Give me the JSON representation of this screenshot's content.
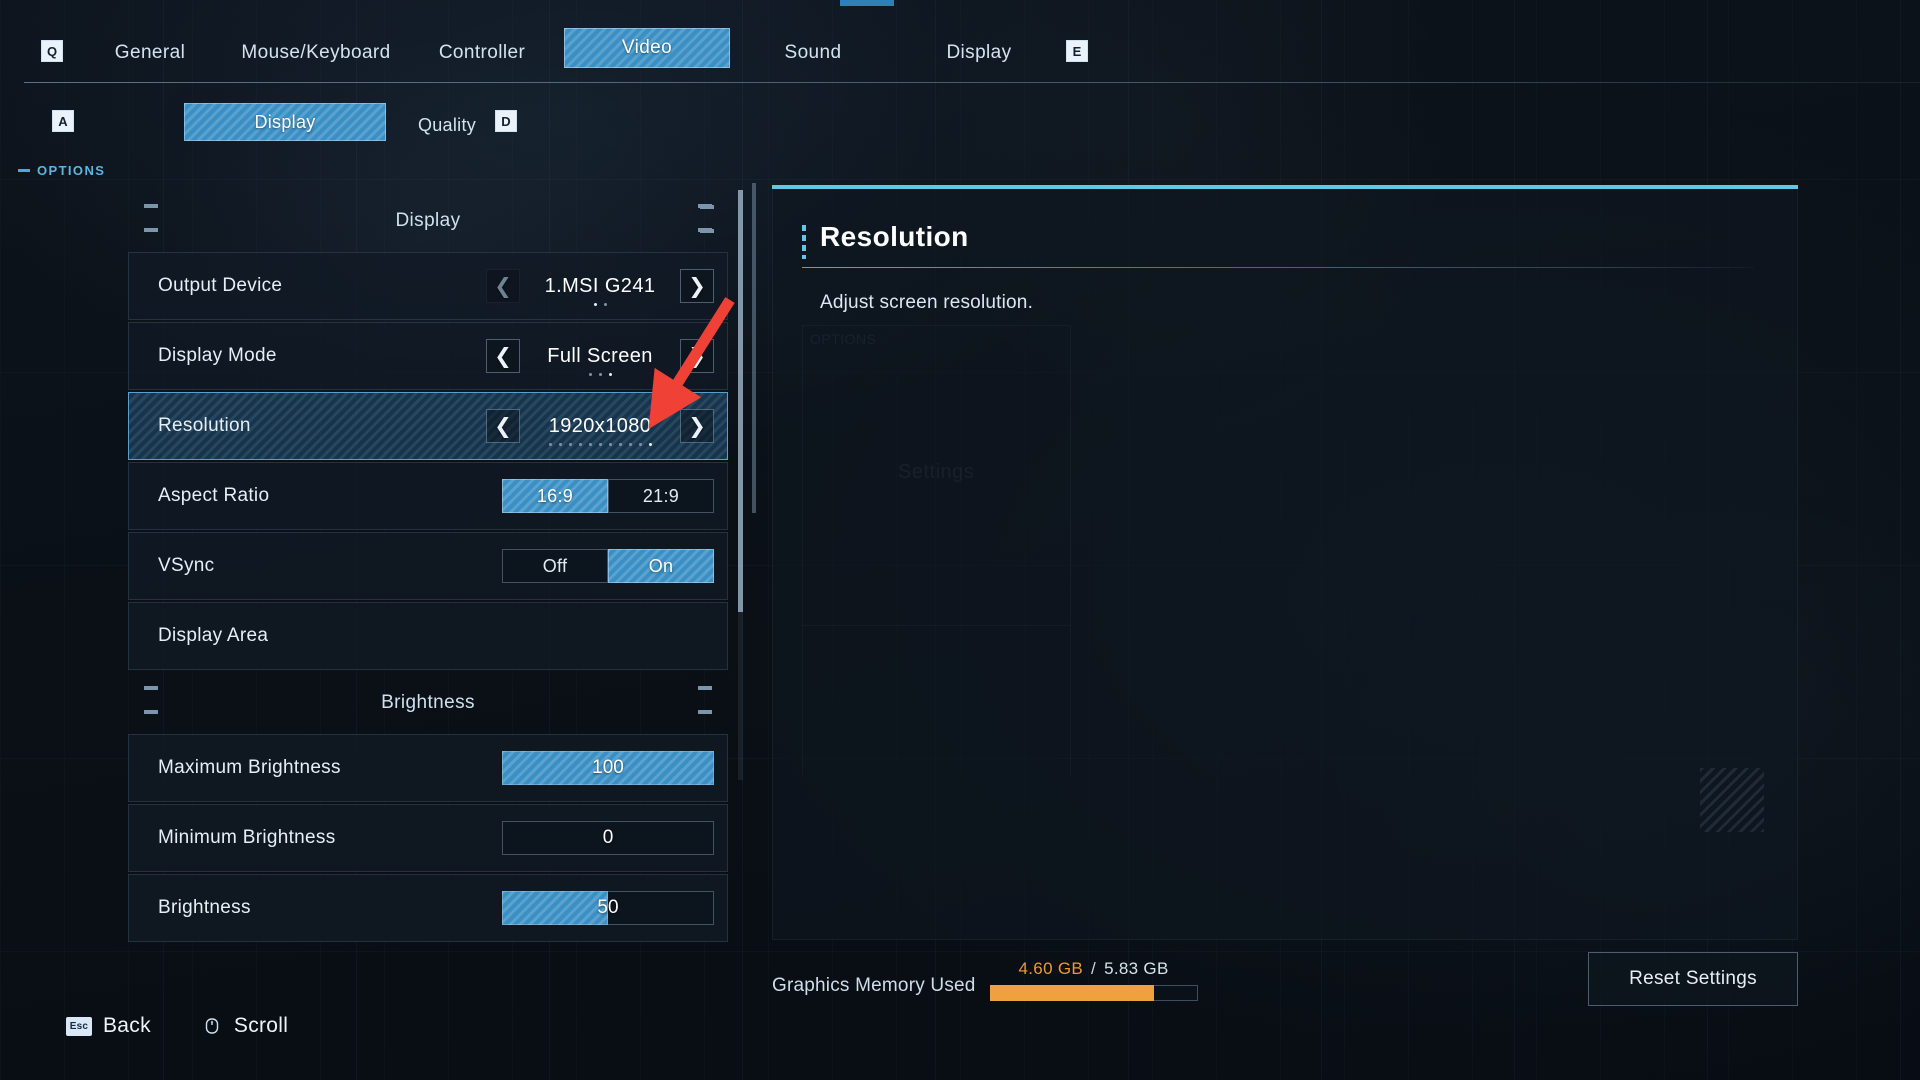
{
  "options_caption": "OPTIONS",
  "top_tabs": {
    "left_key": "Q",
    "right_key": "E",
    "items": [
      {
        "label": "General",
        "active": false
      },
      {
        "label": "Mouse/Keyboard",
        "active": false
      },
      {
        "label": "Controller",
        "active": false
      },
      {
        "label": "Video",
        "active": true
      },
      {
        "label": "Sound",
        "active": false
      },
      {
        "label": "Display",
        "active": false
      }
    ]
  },
  "sub_tabs": {
    "left_key": "A",
    "right_key": "D",
    "items": [
      {
        "label": "Display",
        "active": true
      },
      {
        "label": "Quality",
        "active": false
      }
    ]
  },
  "groups": [
    {
      "title": "Display",
      "rows": [
        {
          "label": "Output Device",
          "type": "stepper",
          "value": "1.MSI G241",
          "dots": 2,
          "dot_active": 0,
          "left_dim": true,
          "selected": false
        },
        {
          "label": "Display Mode",
          "type": "stepper",
          "value": "Full Screen",
          "dots": 3,
          "dot_active": 2,
          "left_dim": false,
          "selected": false
        },
        {
          "label": "Resolution",
          "type": "stepper",
          "value": "1920x1080",
          "dots": 11,
          "dot_active": 10,
          "left_dim": false,
          "selected": true
        },
        {
          "label": "Aspect Ratio",
          "type": "segmented",
          "options": [
            "16:9",
            "21:9"
          ],
          "selected_index": 0,
          "selected": false
        },
        {
          "label": "VSync",
          "type": "segmented",
          "options": [
            "Off",
            "On"
          ],
          "selected_index": 1,
          "selected": false
        },
        {
          "label": "Display Area",
          "type": "none",
          "selected": false
        }
      ]
    },
    {
      "title": "Brightness",
      "rows": [
        {
          "label": "Maximum Brightness",
          "type": "slider",
          "value": "100",
          "percent": 100,
          "selected": false
        },
        {
          "label": "Minimum Brightness",
          "type": "slider",
          "value": "0",
          "percent": 0,
          "selected": false
        },
        {
          "label": "Brightness",
          "type": "slider",
          "value": "50",
          "percent": 50,
          "selected": false
        }
      ]
    }
  ],
  "detail": {
    "title": "Resolution",
    "description": "Adjust screen resolution.",
    "ghost_label": "Settings",
    "ghost_caption": "OPTIONS"
  },
  "memory": {
    "label": "Graphics Memory Used",
    "used": "4.60 GB",
    "separator": "/",
    "total": "5.83 GB",
    "percent": 79
  },
  "reset_button": "Reset Settings",
  "footer": [
    {
      "key": "Esc",
      "key_icon": "escape-key-icon",
      "label": "Back"
    },
    {
      "key": "",
      "key_icon": "mouse-scroll-icon",
      "label": "Scroll"
    }
  ],
  "colors": {
    "accent_blue": "#3a8fc4",
    "accent_cyan": "#63c6e6",
    "memory_orange": "#f0a13f",
    "annotation_red": "#ef4136"
  }
}
